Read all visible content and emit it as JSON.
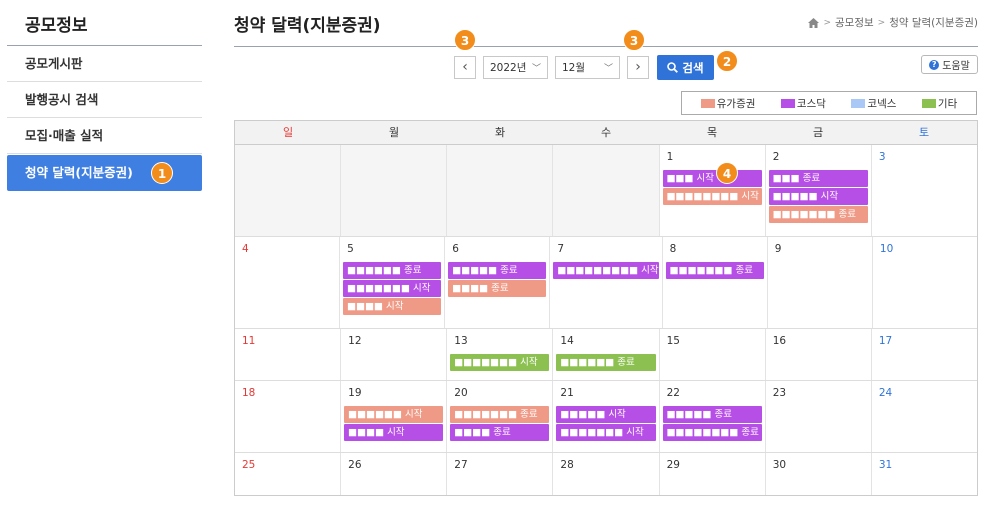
{
  "sidebar": {
    "title": "공모정보",
    "items": [
      {
        "label": "공모게시판"
      },
      {
        "label": "발행공시 검색"
      },
      {
        "label": "모집·매출 실적"
      },
      {
        "label": "청약 달력(지분증권)"
      }
    ]
  },
  "header": {
    "title": "청약 달력(지분증권)",
    "breadcrumb": [
      "공모정보",
      "청약 달력(지분증권)"
    ]
  },
  "controls": {
    "year": "2022년",
    "month": "12월",
    "search_label": "검색",
    "help_label": "도움말"
  },
  "badges": {
    "sidebar": "1",
    "search": "2",
    "prev": "3",
    "next": "3",
    "event": "4"
  },
  "legend": [
    {
      "label": "유가증권",
      "color": "#ef9a86"
    },
    {
      "label": "코스닥",
      "color": "#b64fe6"
    },
    {
      "label": "코넥스",
      "color": "#a9c8f5"
    },
    {
      "label": "기타",
      "color": "#8cc152"
    }
  ],
  "weekdays": [
    "일",
    "월",
    "화",
    "수",
    "목",
    "금",
    "토"
  ],
  "weeks": [
    [
      {
        "day": "",
        "events": []
      },
      {
        "day": "",
        "events": []
      },
      {
        "day": "",
        "events": []
      },
      {
        "day": "",
        "events": []
      },
      {
        "day": "1",
        "events": [
          {
            "text": "■■■ 시작",
            "market": "kosdaq"
          },
          {
            "text": "■■■■■■■■ 시작",
            "market": "kospi"
          }
        ]
      },
      {
        "day": "2",
        "events": [
          {
            "text": "■■■ 종료",
            "market": "kosdaq"
          },
          {
            "text": "■■■■■ 시작",
            "market": "kosdaq"
          },
          {
            "text": "■■■■■■■ 종료",
            "market": "kospi"
          }
        ]
      },
      {
        "day": "3",
        "events": []
      }
    ],
    [
      {
        "day": "4",
        "events": []
      },
      {
        "day": "5",
        "events": [
          {
            "text": "■■■■■■ 종료",
            "market": "kosdaq"
          },
          {
            "text": "■■■■■■■ 시작",
            "market": "kosdaq"
          },
          {
            "text": "■■■■ 시작",
            "market": "kospi"
          }
        ]
      },
      {
        "day": "6",
        "events": [
          {
            "text": "■■■■■ 종료",
            "market": "kosdaq"
          },
          {
            "text": "■■■■ 종료",
            "market": "kospi"
          }
        ]
      },
      {
        "day": "7",
        "events": [
          {
            "text": "■■■■■■■■■ 시작",
            "market": "kosdaq"
          }
        ]
      },
      {
        "day": "8",
        "events": [
          {
            "text": "■■■■■■■ 종료",
            "market": "kosdaq"
          }
        ]
      },
      {
        "day": "9",
        "events": []
      },
      {
        "day": "10",
        "events": []
      }
    ],
    [
      {
        "day": "11",
        "events": []
      },
      {
        "day": "12",
        "events": []
      },
      {
        "day": "13",
        "events": [
          {
            "text": "■■■■■■■ 시작",
            "market": "etc"
          }
        ]
      },
      {
        "day": "14",
        "events": [
          {
            "text": "■■■■■■ 종료",
            "market": "etc"
          }
        ]
      },
      {
        "day": "15",
        "events": []
      },
      {
        "day": "16",
        "events": []
      },
      {
        "day": "17",
        "events": []
      }
    ],
    [
      {
        "day": "18",
        "events": []
      },
      {
        "day": "19",
        "events": [
          {
            "text": "■■■■■■ 시작",
            "market": "kospi"
          },
          {
            "text": "■■■■ 시작",
            "market": "kosdaq"
          }
        ]
      },
      {
        "day": "20",
        "events": [
          {
            "text": "■■■■■■■ 종료",
            "market": "kospi"
          },
          {
            "text": "■■■■ 종료",
            "market": "kosdaq"
          }
        ]
      },
      {
        "day": "21",
        "events": [
          {
            "text": "■■■■■ 시작",
            "market": "kosdaq"
          },
          {
            "text": "■■■■■■■ 시작",
            "market": "kosdaq"
          }
        ]
      },
      {
        "day": "22",
        "events": [
          {
            "text": "■■■■■ 종료",
            "market": "kosdaq"
          },
          {
            "text": "■■■■■■■■ 종료",
            "market": "kosdaq"
          }
        ]
      },
      {
        "day": "23",
        "events": []
      },
      {
        "day": "24",
        "events": []
      }
    ],
    [
      {
        "day": "25",
        "events": []
      },
      {
        "day": "26",
        "events": []
      },
      {
        "day": "27",
        "events": []
      },
      {
        "day": "28",
        "events": []
      },
      {
        "day": "29",
        "events": []
      },
      {
        "day": "30",
        "events": []
      },
      {
        "day": "31",
        "events": []
      }
    ]
  ]
}
